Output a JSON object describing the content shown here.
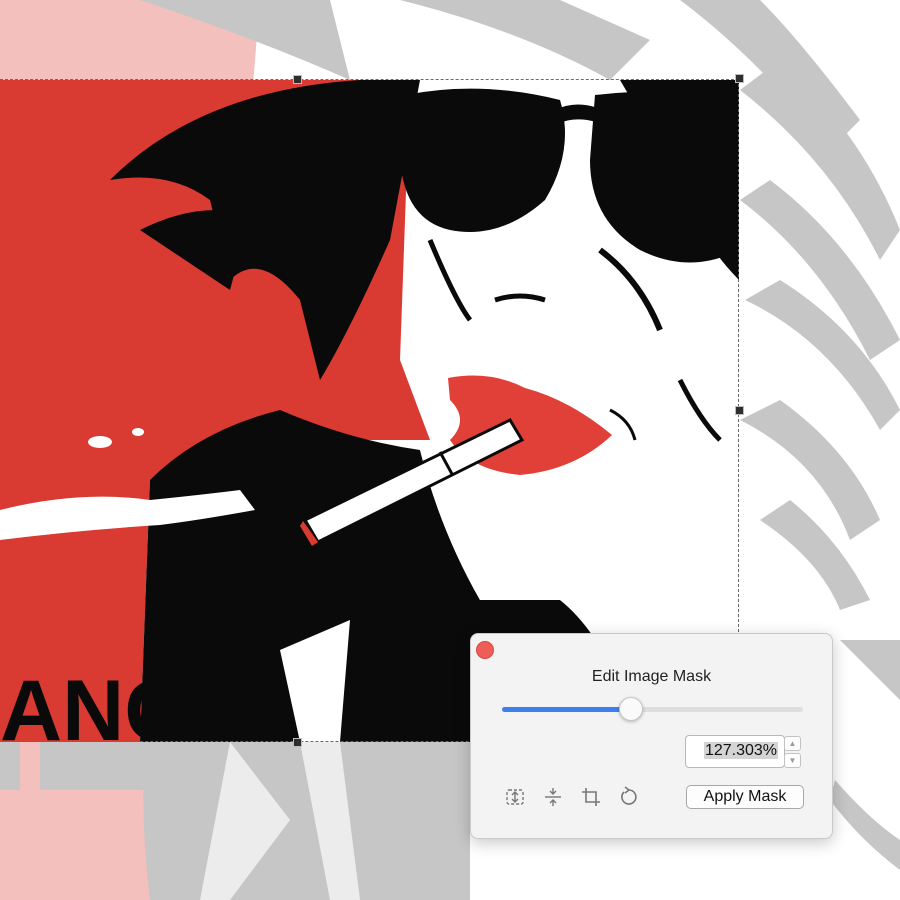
{
  "mask_panel": {
    "title": "Edit Image Mask",
    "scale_value": "127.303%",
    "slider_fraction": 0.427,
    "apply_label": "Apply Mask",
    "tools": [
      "fit-icon",
      "center-icon",
      "crop-icon",
      "rotate-icon"
    ]
  },
  "artwork": {
    "visible_text": "ANG"
  },
  "colors": {
    "accent": "#3e7ff0",
    "close": "#ee5d56",
    "art_red": "#d93a32",
    "faded_red": "#f3c0bd",
    "faded_gray": "#c6c6c6"
  }
}
